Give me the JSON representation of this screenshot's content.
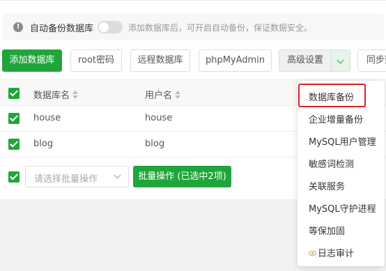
{
  "notice": {
    "label": "自动备份数据库",
    "hint": "添加数据库后，可开启自动备份，保证数据安全。",
    "toggle_on": false
  },
  "toolbar": {
    "add_db": "添加数据库",
    "root_pwd": "root密码",
    "remote_db": "远程数据库",
    "phpmyadmin": "phpMyAdmin",
    "advanced": "高级设置",
    "sync": "同步数"
  },
  "table": {
    "columns": [
      "数据库名",
      "用户名"
    ],
    "rows": [
      {
        "db": "house",
        "user": "house",
        "checked": true
      },
      {
        "db": "blog",
        "user": "blog",
        "checked": true
      }
    ],
    "trunc_text": "··"
  },
  "bottom": {
    "select_placeholder": "请选择批量操作",
    "batch_button": "批量操作 (已选中2项)"
  },
  "dropdown": {
    "items": [
      "数据库备份",
      "企业增量备份",
      "MySQL用户管理",
      "敏感词检测",
      "关联服务",
      "MySQL守护进程",
      "等保加固",
      "日志审计"
    ],
    "highlighted_index": 0
  },
  "colors": {
    "accent": "#20a53a",
    "highlight_border": "#e02020"
  }
}
